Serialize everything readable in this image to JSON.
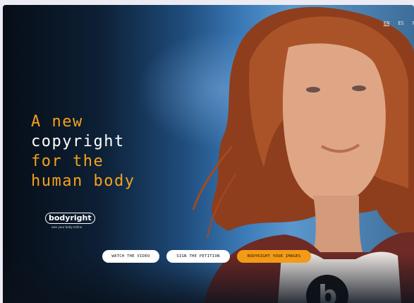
{
  "nav": {
    "languages": [
      "EN",
      "ES",
      "F"
    ],
    "active_language": "EN"
  },
  "hero": {
    "headline_lines": [
      {
        "text": "A new",
        "color": "#f4a21c"
      },
      {
        "text": "copyright",
        "color": "#ffffff"
      },
      {
        "text": "for the",
        "color": "#f4a21c"
      },
      {
        "text": "human body",
        "color": "#f4a21c"
      }
    ]
  },
  "brand": {
    "name": "bodyright",
    "tagline": "own your body online"
  },
  "actions": {
    "watch_video": "WATCH THE VIDEO",
    "sign_petition": "SIGN THE PETITION",
    "bodyright_images": "BODYRIGHT YOUR IMAGES"
  },
  "colors": {
    "accent": "#f4a21c",
    "button_white": "#ffffff",
    "button_orange": "#f39a17"
  }
}
